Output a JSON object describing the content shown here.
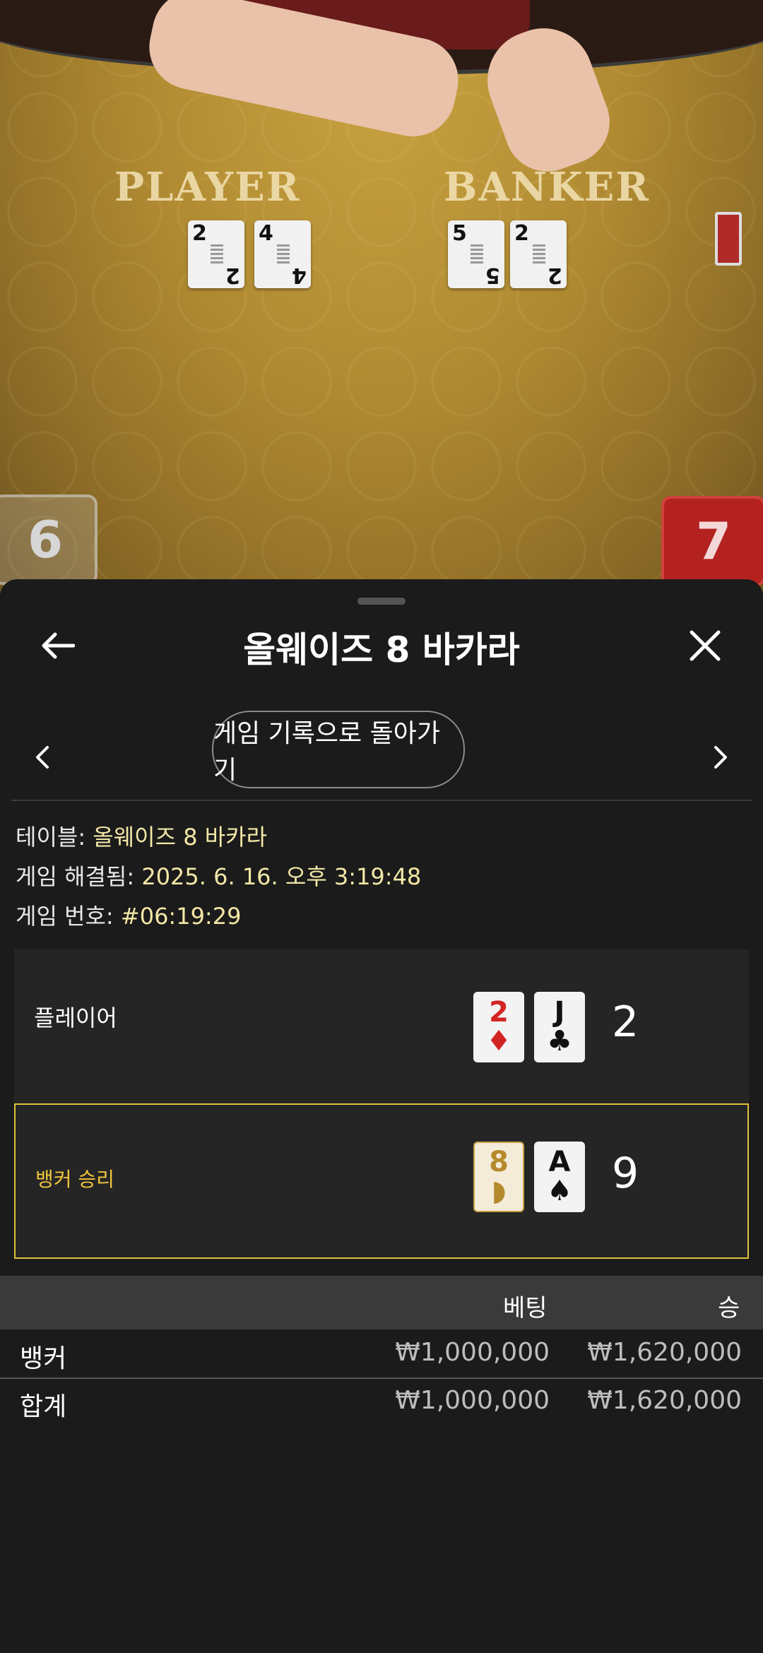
{
  "video": {
    "player_label": "PLAYER",
    "banker_label": "BANKER",
    "player_cards": [
      {
        "rank": "2",
        "suit": "♣"
      },
      {
        "rank": "4",
        "suit": "♣"
      }
    ],
    "banker_cards": [
      {
        "rank": "5",
        "suit": "♣"
      },
      {
        "rank": "2",
        "suit": "♠"
      }
    ],
    "player_score": "6",
    "banker_score": "7"
  },
  "header": {
    "title": "올웨이즈 8 바카라",
    "back_icon": "arrow-left-icon",
    "close_icon": "close-icon"
  },
  "nav": {
    "history_button": "게임 기록으로 돌아가기",
    "prev_icon": "chevron-left-icon",
    "next_icon": "chevron-right-icon"
  },
  "info": {
    "table_label": "테이블: ",
    "table_value": "올웨이즈 8 바카라",
    "resolved_label": "게임 해결됨: ",
    "resolved_value": "2025. 6. 16. 오후 3:19:48",
    "number_label": "게임 번호: ",
    "number_value": "#06:19:29"
  },
  "hands": {
    "player": {
      "label": "플레이어",
      "cards": [
        {
          "rank": "2",
          "suit": "♦",
          "color": "red"
        },
        {
          "rank": "J",
          "suit": "♣",
          "color": "black"
        }
      ],
      "score": "2"
    },
    "banker": {
      "label": "뱅커 승리",
      "cards": [
        {
          "rank": "8",
          "suit": "◗",
          "color": "gold"
        },
        {
          "rank": "A",
          "suit": "♠",
          "color": "black"
        }
      ],
      "score": "9"
    }
  },
  "bets": {
    "col_bet": "베팅",
    "col_win": "승",
    "rows": [
      {
        "label": "뱅커",
        "bet": "₩1,000,000",
        "win": "₩1,620,000"
      },
      {
        "label": "합계",
        "bet": "₩1,000,000",
        "win": "₩1,620,000"
      }
    ]
  },
  "colors": {
    "accent_gold": "#e0c23a",
    "value_text": "#f3e8a6",
    "sheet_bg": "#1b1b1b",
    "row_bg": "#252525",
    "banker_score_bg": "#b3221f"
  }
}
